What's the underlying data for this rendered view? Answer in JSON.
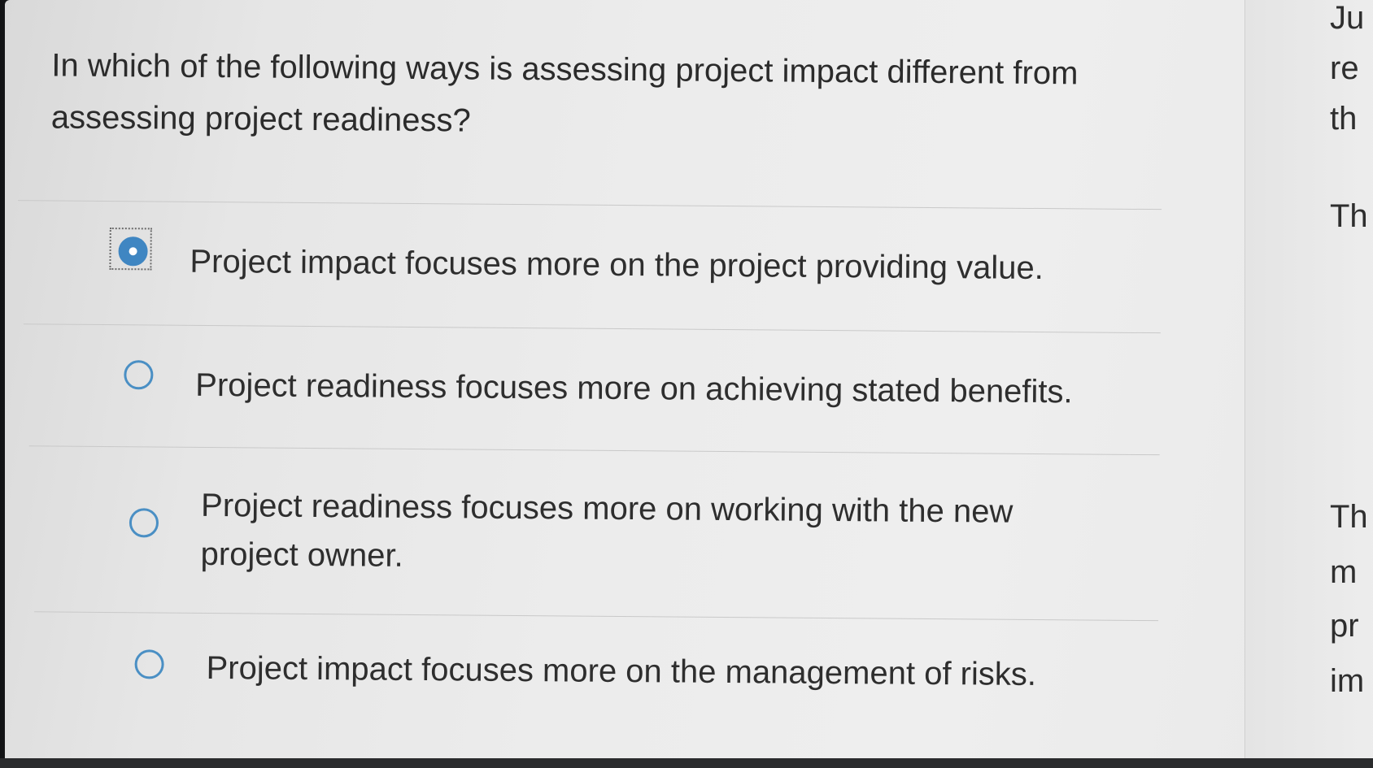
{
  "question": {
    "text": "In which of the following ways is assessing project impact different from assessing project readiness?"
  },
  "options": [
    {
      "label": "Project impact focuses more on the project providing value.",
      "selected": true
    },
    {
      "label": "Project readiness focuses more on achieving stated benefits.",
      "selected": false
    },
    {
      "label": "Project readiness focuses more on working with the new project owner.",
      "selected": false
    },
    {
      "label": "Project impact focuses more on the management of risks.",
      "selected": false
    }
  ],
  "side_panel": {
    "fragments": [
      "Ju",
      "re",
      "th",
      "Th",
      "Th",
      "m",
      "pr",
      "im"
    ]
  },
  "colors": {
    "radio_accent": "#3f86c2",
    "text": "#2e2e2e",
    "background": "#ececec"
  }
}
